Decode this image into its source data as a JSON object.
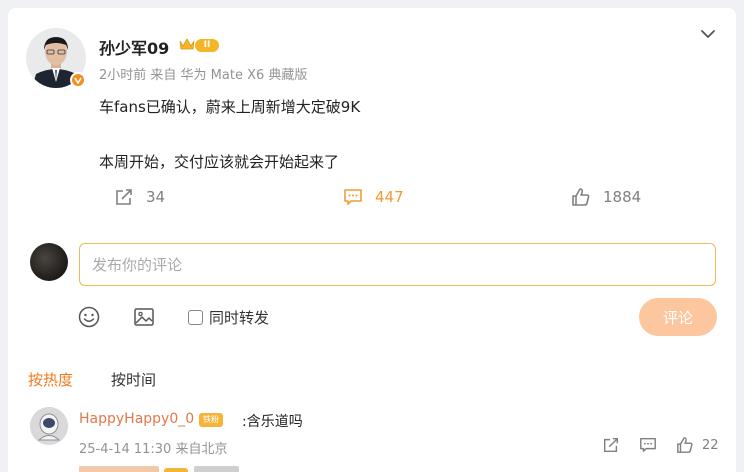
{
  "post": {
    "author": "孙少军09",
    "level_badge": "II",
    "meta": "2小时前 来自 华为 Mate X6 典藏版",
    "lines": [
      "车fans已确认，蔚来上周新增大定破9K",
      "本周开始，交付应该就会开始起来了"
    ],
    "reposts": "34",
    "comments": "447",
    "likes": "1884"
  },
  "composer": {
    "placeholder": "发布你的评论",
    "repost_label": "同时转发",
    "submit_label": "评论"
  },
  "sort": {
    "hot": "按热度",
    "time": "按时间"
  },
  "comments": [
    {
      "name": "HappyHappy0_0",
      "fan_badge": "铁粉",
      "text": ":含乐道吗",
      "meta": "25-4-14 11:30 来自北京",
      "likes": "22"
    }
  ],
  "colors": {
    "accent": "#f07b20",
    "comment_count": "#f09a36",
    "submit_bg": "#fcc79e",
    "input_border": "#f0b95c",
    "commenter_name": "#e0794a"
  },
  "icons": [
    "chevron-down-icon",
    "share-icon",
    "comment-icon",
    "like-icon",
    "emoji-icon",
    "image-icon",
    "verified-icon",
    "crown-icon"
  ]
}
